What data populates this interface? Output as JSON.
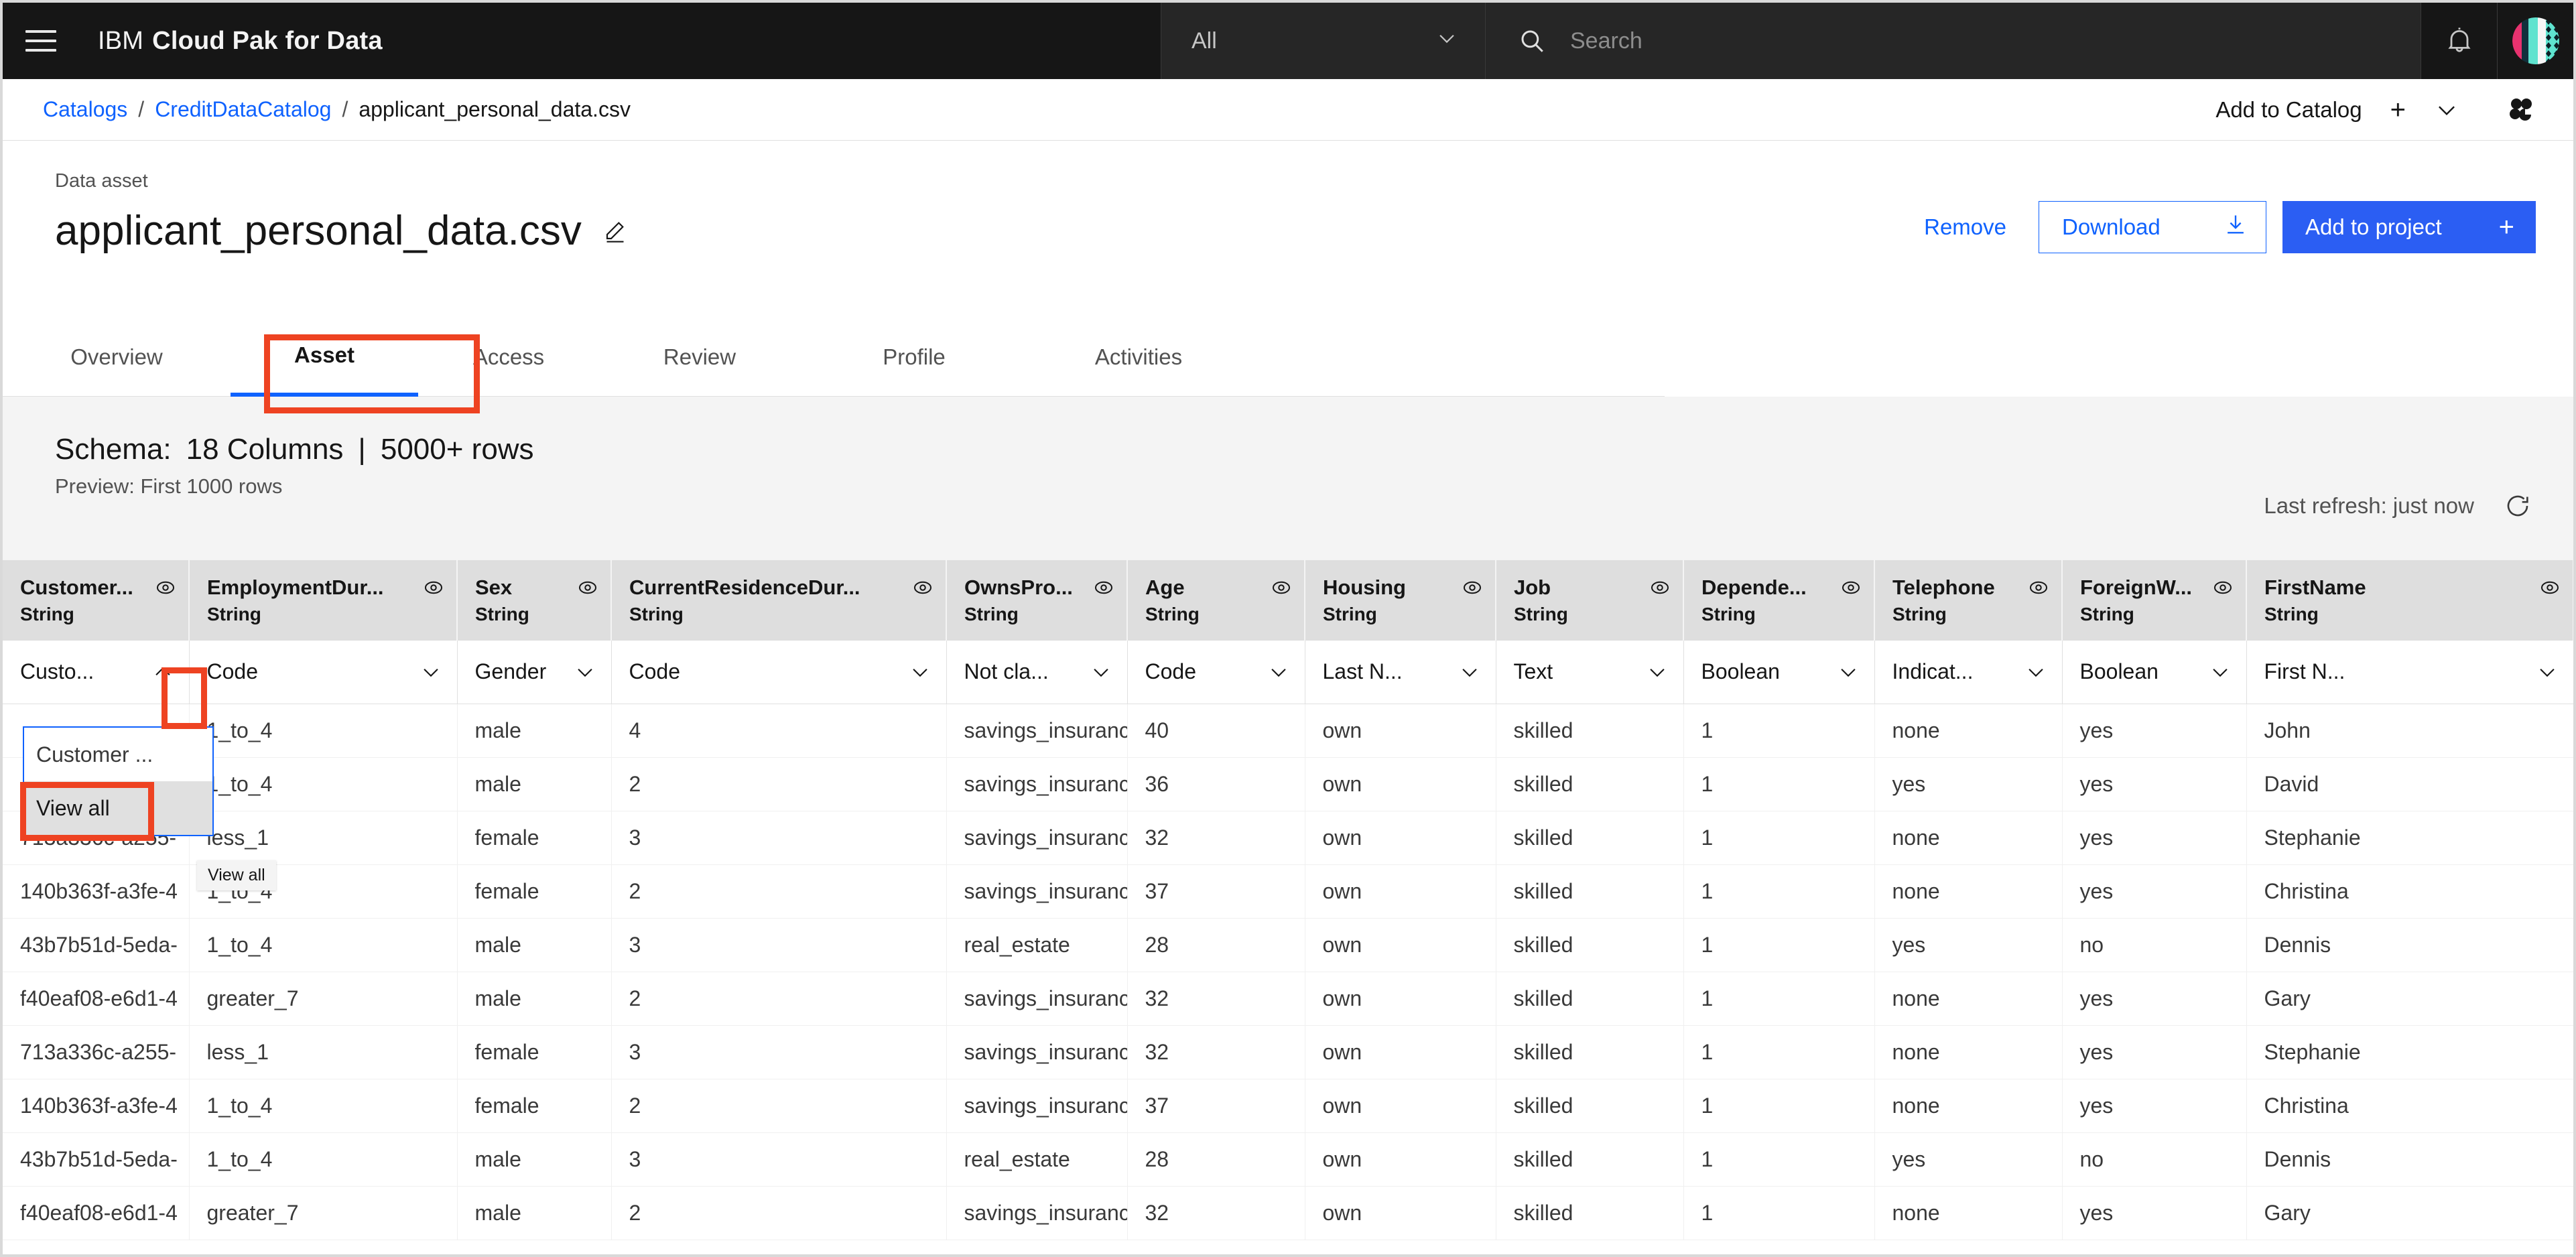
{
  "topbar": {
    "brand_prefix": "IBM",
    "brand_name": "Cloud Pak for Data",
    "scope_value": "All",
    "search_placeholder": "Search",
    "menu_icon": "hamburger-menu-icon",
    "search_icon": "search-icon",
    "notification_icon": "bell-icon",
    "avatar_icon": "user-avatar"
  },
  "breadcrumb": {
    "items": [
      {
        "label": "Catalogs",
        "link": true
      },
      {
        "label": "CreditDataCatalog",
        "link": true
      },
      {
        "label": "applicant_personal_data.csv",
        "link": false
      }
    ],
    "separator": "/",
    "add_to_catalog": "Add to Catalog",
    "plus": "+",
    "chevron_icon": "chevron-down-icon",
    "cpd_logo_icon": "cloud-pak-logo-icon"
  },
  "title": {
    "eyebrow": "Data asset",
    "name": "applicant_personal_data.csv",
    "edit_icon": "pencil-edit-icon",
    "remove_label": "Remove",
    "download_label": "Download",
    "download_icon": "download-icon",
    "add_to_project_label": "Add to project",
    "add_to_project_plus": "+"
  },
  "tabs": [
    {
      "label": "Overview",
      "active": false
    },
    {
      "label": "Asset",
      "active": true
    },
    {
      "label": "Access",
      "active": false
    },
    {
      "label": "Review",
      "active": false
    },
    {
      "label": "Profile",
      "active": false
    },
    {
      "label": "Activities",
      "active": false
    }
  ],
  "schema": {
    "label": "Schema:",
    "columns": "18 Columns",
    "pipe": "|",
    "rows": "5000+ rows",
    "preview": "Preview: First 1000 rows",
    "last_refresh": "Last refresh: just now",
    "refresh_icon": "refresh-icon"
  },
  "table": {
    "eye_icon": "eye-icon",
    "chevron_down_icon": "chevron-down-icon",
    "chevron_up_icon": "chevron-up-icon",
    "columns": [
      {
        "name": "Customer...",
        "type": "String",
        "eye": true,
        "filter": "Custo...",
        "open": true
      },
      {
        "name": "EmploymentDur...",
        "type": "String",
        "eye": true,
        "filter": "Code",
        "open": false
      },
      {
        "name": "Sex",
        "type": "String",
        "eye": true,
        "filter": "Gender",
        "open": false
      },
      {
        "name": "CurrentResidenceDur...",
        "type": "String",
        "eye": true,
        "filter": "Code",
        "open": false
      },
      {
        "name": "OwnsPro...",
        "type": "String",
        "eye": true,
        "filter": "Not cla...",
        "open": false
      },
      {
        "name": "Age",
        "type": "String",
        "eye": true,
        "filter": "Code",
        "open": false
      },
      {
        "name": "Housing",
        "type": "String",
        "eye": true,
        "filter": "Last N...",
        "open": false
      },
      {
        "name": "Job",
        "type": "String",
        "eye": true,
        "filter": "Text",
        "open": false
      },
      {
        "name": "Depende...",
        "type": "String",
        "eye": true,
        "filter": "Boolean",
        "open": false
      },
      {
        "name": "Telephone",
        "type": "String",
        "eye": true,
        "filter": "Indicat...",
        "open": false
      },
      {
        "name": "ForeignW...",
        "type": "String",
        "eye": true,
        "filter": "Boolean",
        "open": false
      },
      {
        "name": "FirstName",
        "type": "String",
        "eye": true,
        "filter": "First N...",
        "open": false
      }
    ],
    "rows": [
      [
        "",
        "1_to_4",
        "male",
        "4",
        "savings_insuranc",
        "40",
        "own",
        "skilled",
        "1",
        "none",
        "yes",
        "John"
      ],
      [
        "",
        "1_to_4",
        "male",
        "2",
        "savings_insuranc",
        "36",
        "own",
        "skilled",
        "1",
        "yes",
        "yes",
        "David"
      ],
      [
        "713a336c-a255-",
        "less_1",
        "female",
        "3",
        "savings_insuranc",
        "32",
        "own",
        "skilled",
        "1",
        "none",
        "yes",
        "Stephanie"
      ],
      [
        "140b363f-a3fe-4",
        "1_to_4",
        "female",
        "2",
        "savings_insuranc",
        "37",
        "own",
        "skilled",
        "1",
        "none",
        "yes",
        "Christina"
      ],
      [
        "43b7b51d-5eda-",
        "1_to_4",
        "male",
        "3",
        "real_estate",
        "28",
        "own",
        "skilled",
        "1",
        "yes",
        "no",
        "Dennis"
      ],
      [
        "f40eaf08-e6d1-4",
        "greater_7",
        "male",
        "2",
        "savings_insuranc",
        "32",
        "own",
        "skilled",
        "1",
        "none",
        "yes",
        "Gary"
      ],
      [
        "713a336c-a255-",
        "less_1",
        "female",
        "3",
        "savings_insuranc",
        "32",
        "own",
        "skilled",
        "1",
        "none",
        "yes",
        "Stephanie"
      ],
      [
        "140b363f-a3fe-4",
        "1_to_4",
        "female",
        "2",
        "savings_insuranc",
        "37",
        "own",
        "skilled",
        "1",
        "none",
        "yes",
        "Christina"
      ],
      [
        "43b7b51d-5eda-",
        "1_to_4",
        "male",
        "3",
        "real_estate",
        "28",
        "own",
        "skilled",
        "1",
        "yes",
        "no",
        "Dennis"
      ],
      [
        "f40eaf08-e6d1-4",
        "greater_7",
        "male",
        "2",
        "savings_insuranc",
        "32",
        "own",
        "skilled",
        "1",
        "none",
        "yes",
        "Gary"
      ]
    ]
  },
  "dropdown": {
    "options": [
      {
        "label": "Customer ...",
        "selected": false
      },
      {
        "label": "View all",
        "selected": true
      }
    ],
    "tooltip": "View all"
  },
  "colors": {
    "accent_blue": "#0f62fe",
    "primary_button": "#2b5ef3",
    "annotation_red": "#ee4322",
    "header_gray": "#dedede",
    "nav_black": "#161616"
  }
}
